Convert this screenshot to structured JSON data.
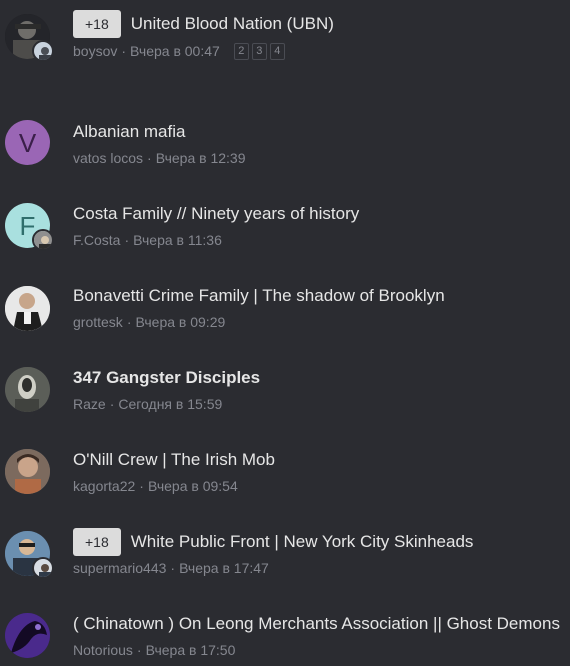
{
  "threads": [
    {
      "prefix": "+18",
      "title": "United Blood Nation (UBN)",
      "author": "boysov",
      "time": "Вчера в 00:47",
      "pages": [
        "2",
        "3",
        "4"
      ]
    },
    {
      "avatar_letter": "V",
      "avatar_color": "#9a66b5",
      "title": "Albanian mafia",
      "author": "vatos locos",
      "time": "Вчера в 12:39"
    },
    {
      "avatar_letter": "F",
      "avatar_color": "#a9e0df",
      "title": "Costa Family // Ninety years of history",
      "author": "F.Costa",
      "time": "Вчера в 11:36"
    },
    {
      "title": "Bonavetti Crime Family | The shadow of Brooklyn",
      "author": "grottesk",
      "time": "Вчера в 09:29"
    },
    {
      "title": "347 Gangster Disciples",
      "author": "Raze",
      "time": "Сегодня в 15:59"
    },
    {
      "title": "O'Nill Crew | The Irish Mob",
      "author": "kagorta22",
      "time": "Вчера в 09:54"
    },
    {
      "prefix": "+18",
      "title": "White Public Front | New York City Skinheads",
      "author": "supermario443",
      "time": "Вчера в 17:47"
    },
    {
      "title": "( Chinatown ) On Leong Merchants Association || Ghost Demons",
      "author": "Notorious",
      "time": "Вчера в 17:50"
    }
  ],
  "meta_separator": "·"
}
